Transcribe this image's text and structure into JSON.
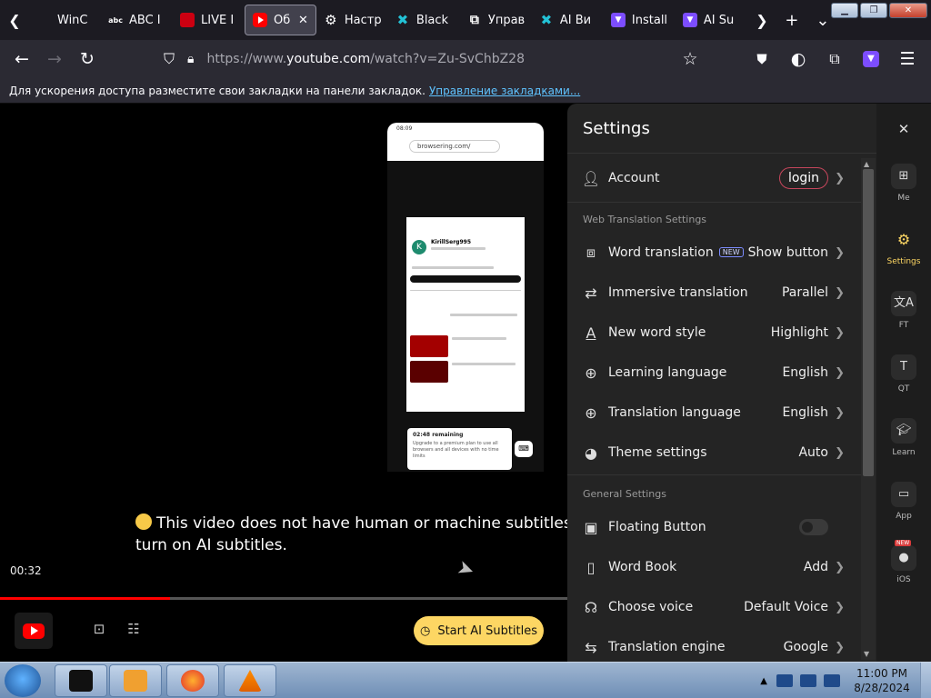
{
  "browser": {
    "tabs": [
      {
        "title": "WinC",
        "icon": "blank"
      },
      {
        "title": "ABC I",
        "icon": "abc-logo"
      },
      {
        "title": "LIVE I",
        "icon": "live-logo"
      },
      {
        "title": "Об",
        "icon": "youtube-logo",
        "active": true
      },
      {
        "title": "Настр",
        "icon": "gear-icon"
      },
      {
        "title": "Black",
        "icon": "x-logo"
      },
      {
        "title": "Управ",
        "icon": "puzzle-icon"
      },
      {
        "title": "AI Ви",
        "icon": "x-logo"
      },
      {
        "title": "Install",
        "icon": "ai-logo"
      },
      {
        "title": "AI Su",
        "icon": "ai-logo"
      }
    ],
    "url_prefix": "https://www.",
    "url_domain": "youtube.com",
    "url_path": "/watch?v=Zu-SvChbZ28",
    "bookmarks_text": "Для ускорения доступа разместите свои закладки на панели закладок.",
    "bookmarks_link": "Управление закладками..."
  },
  "video": {
    "subtitle_line1": "This video does not have human or machine subtitles. Ple",
    "subtitle_line2": "turn on AI subtitles.",
    "current_time": "00:32",
    "progress": 0.3,
    "ai_button": "Start AI Subtitles",
    "phone": {
      "status_time": "08:09",
      "url": "browsering.com/",
      "channel_initial": "K",
      "channel_name": "KirillSerg995",
      "card_title": "02:48 remaining",
      "card_body": "Upgrade to a premium plan to use all browsers and all devices with no time limits"
    }
  },
  "settings": {
    "title": "Settings",
    "account_label": "Account",
    "login_label": "login",
    "section_web": "Web Translation Settings",
    "section_general": "General Settings",
    "web_rows": [
      {
        "label": "Word translation",
        "value": "Show button",
        "badge": "NEW",
        "icon": "word-translation-icon"
      },
      {
        "label": "Immersive translation",
        "value": "Parallel",
        "icon": "immersive-translation-icon"
      },
      {
        "label": "New word style",
        "value": "Highlight",
        "icon": "text-style-icon"
      },
      {
        "label": "Learning language",
        "value": "English",
        "icon": "globe-icon"
      },
      {
        "label": "Translation language",
        "value": "English",
        "icon": "globe-icon"
      },
      {
        "label": "Theme settings",
        "value": "Auto",
        "icon": "palette-icon"
      }
    ],
    "general_rows": [
      {
        "label": "Floating Button",
        "value": "",
        "toggle": false,
        "icon": "floating-button-icon"
      },
      {
        "label": "Word Book",
        "value": "Add",
        "icon": "book-icon"
      },
      {
        "label": "Choose voice",
        "value": "Default Voice",
        "icon": "voice-icon"
      },
      {
        "label": "Translation engine",
        "value": "Google",
        "icon": "engine-icon"
      }
    ]
  },
  "rail": {
    "items": [
      {
        "label": "Me",
        "icon": "grid-icon"
      },
      {
        "label": "Settings",
        "icon": "gear-icon",
        "active": true
      },
      {
        "label": "FT",
        "icon": "translate-icon"
      },
      {
        "label": "QT",
        "icon": "quick-translate-icon"
      },
      {
        "label": "Learn",
        "icon": "graduation-cap-icon"
      },
      {
        "label": "App",
        "icon": "devices-icon"
      },
      {
        "label": "iOS",
        "icon": "apple-icon",
        "badge": "NEW"
      }
    ]
  },
  "taskbar": {
    "time": "11:00 PM",
    "date": "8/28/2024"
  },
  "colors": {
    "accent": "#fdd663",
    "login_border": "#c7465c",
    "progress": "#ff0000"
  }
}
